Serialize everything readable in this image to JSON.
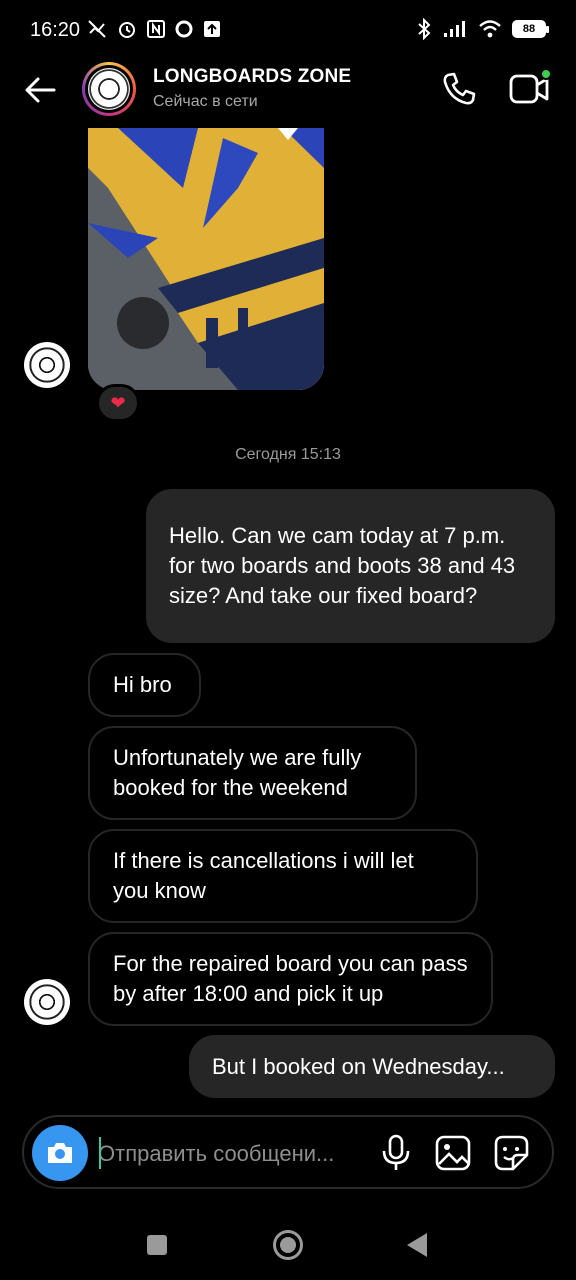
{
  "status_bar": {
    "time": "16:20",
    "battery": "88"
  },
  "header": {
    "name": "LONGBOARDS ZONE",
    "status": "Сейчас в сети"
  },
  "photo_message": {
    "reaction": "❤"
  },
  "date_divider": "Сегодня 15:13",
  "messages": [
    {
      "direction": "outgoing",
      "text": "Hello. Can we cam today at 7 p.m. for two boards and boots 38 and 43 size? And take our fixed board?"
    },
    {
      "direction": "incoming",
      "text": "Hi bro"
    },
    {
      "direction": "incoming",
      "text": "Unfortunately we are fully booked for the weekend"
    },
    {
      "direction": "incoming",
      "text": "If there is cancellations i will let you know"
    },
    {
      "direction": "incoming",
      "text": "For the repaired board you can pass by after 18:00 and pick it up"
    },
    {
      "direction": "outgoing",
      "text": "But I booked on Wednesday..."
    }
  ],
  "composer": {
    "placeholder": "Отправить сообщени..."
  },
  "icons": {
    "back": "arrow-left-icon",
    "call": "phone-icon",
    "video": "video-camera-icon",
    "camera": "camera-icon",
    "mic": "microphone-icon",
    "gallery": "image-icon",
    "sticker": "sticker-icon"
  },
  "colors": {
    "background": "#000000",
    "outgoing_bubble": "#262626",
    "incoming_border": "#262626",
    "accent_blue": "#3797f0",
    "online_green": "#3ccf4e"
  }
}
